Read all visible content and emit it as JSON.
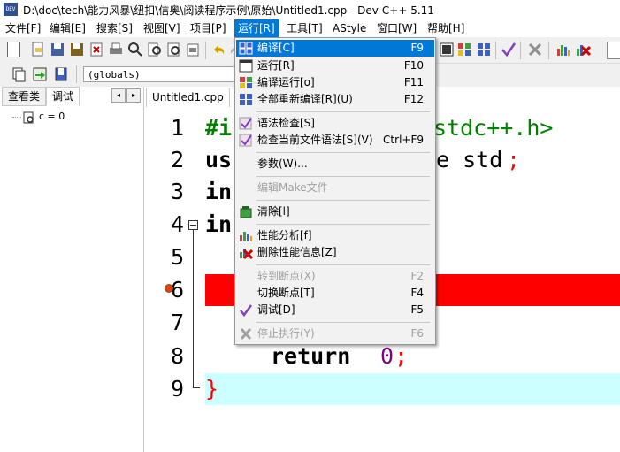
{
  "window": {
    "title": "D:\\doc\\tech\\能力风暴\\纽扣\\信奥\\阅读程序示例\\原始\\Untitled1.cpp - Dev-C++ 5.11",
    "app_icon_text": "DEV"
  },
  "menubar": {
    "items": [
      {
        "label": "文件[F]"
      },
      {
        "label": "编辑[E]"
      },
      {
        "label": "搜索[S]"
      },
      {
        "label": "视图[V]"
      },
      {
        "label": "项目[P]"
      },
      {
        "label": "运行[R]"
      },
      {
        "label": "工具[T]"
      },
      {
        "label": "AStyle"
      },
      {
        "label": "窗口[W]"
      },
      {
        "label": "帮助[H]"
      }
    ]
  },
  "toolbar2": {
    "scope_selector": "(globals)"
  },
  "left_panel": {
    "tabs": [
      "查看类",
      "调试"
    ],
    "nav_prev": "◂",
    "nav_next": "▸",
    "tree_item": "c = 0"
  },
  "editor": {
    "tab_label": "Untitled1.cpp",
    "line_numbers": [
      "1",
      "2",
      "3",
      "4",
      "5",
      "6",
      "7",
      "8",
      "9"
    ],
    "code": [
      {
        "text": "#i"
      },
      {
        "text": "us"
      },
      {
        "text": "in"
      },
      {
        "text": "in"
      },
      {
        "text": ""
      },
      {
        "text": ""
      },
      {
        "text": ""
      },
      {
        "text": "    return 0;"
      },
      {
        "text": "}"
      }
    ],
    "code_tail": {
      "line1": "stdc++.h>",
      "line2_a": "e std",
      "line2_b": ";",
      "line8_kw": "return",
      "line8_num": "0",
      "line8_semi": ";",
      "line9": "}"
    },
    "colors": {
      "preprocessor": "#008000",
      "keyword": "#000000",
      "number": "#800080",
      "brace": "#ff0000",
      "breakpoint_line": "#ff0000",
      "current_line": "#ccffff"
    }
  },
  "run_menu": {
    "items": [
      {
        "label": "编译[C]",
        "shortcut": "F9",
        "state": "highlighted",
        "icon": "compile-icon"
      },
      {
        "label": "运行[R]",
        "shortcut": "F10",
        "state": "enabled",
        "icon": "run-icon"
      },
      {
        "label": "编译运行[o]",
        "shortcut": "F11",
        "state": "enabled",
        "icon": "compile-run-icon"
      },
      {
        "label": "全部重新编译[R](U)",
        "shortcut": "F12",
        "state": "enabled",
        "icon": "rebuild-icon"
      },
      {
        "label": "语法检查[S]",
        "shortcut": "",
        "state": "enabled",
        "icon": "syntax-check-icon"
      },
      {
        "label": "检查当前文件语法[S](V)",
        "shortcut": "Ctrl+F9",
        "state": "enabled",
        "icon": "syntax-check-file-icon"
      },
      {
        "label": "参数(W)...",
        "shortcut": "",
        "state": "enabled",
        "icon": ""
      },
      {
        "label": "编辑Make文件",
        "shortcut": "",
        "state": "disabled",
        "icon": ""
      },
      {
        "label": "清除[l]",
        "shortcut": "",
        "state": "enabled",
        "icon": "clean-icon"
      },
      {
        "label": "性能分析[f]",
        "shortcut": "",
        "state": "enabled",
        "icon": "profile-icon"
      },
      {
        "label": "删除性能信息[Z]",
        "shortcut": "",
        "state": "enabled",
        "icon": "delete-profile-icon"
      },
      {
        "label": "转到断点(X)",
        "shortcut": "F2",
        "state": "disabled",
        "icon": ""
      },
      {
        "label": "切换断点[T]",
        "shortcut": "F4",
        "state": "enabled",
        "icon": ""
      },
      {
        "label": "调试[D]",
        "shortcut": "F5",
        "state": "enabled",
        "icon": "debug-check-icon"
      },
      {
        "label": "停止执行(Y)",
        "shortcut": "F6",
        "state": "disabled",
        "icon": "stop-icon"
      }
    ]
  }
}
